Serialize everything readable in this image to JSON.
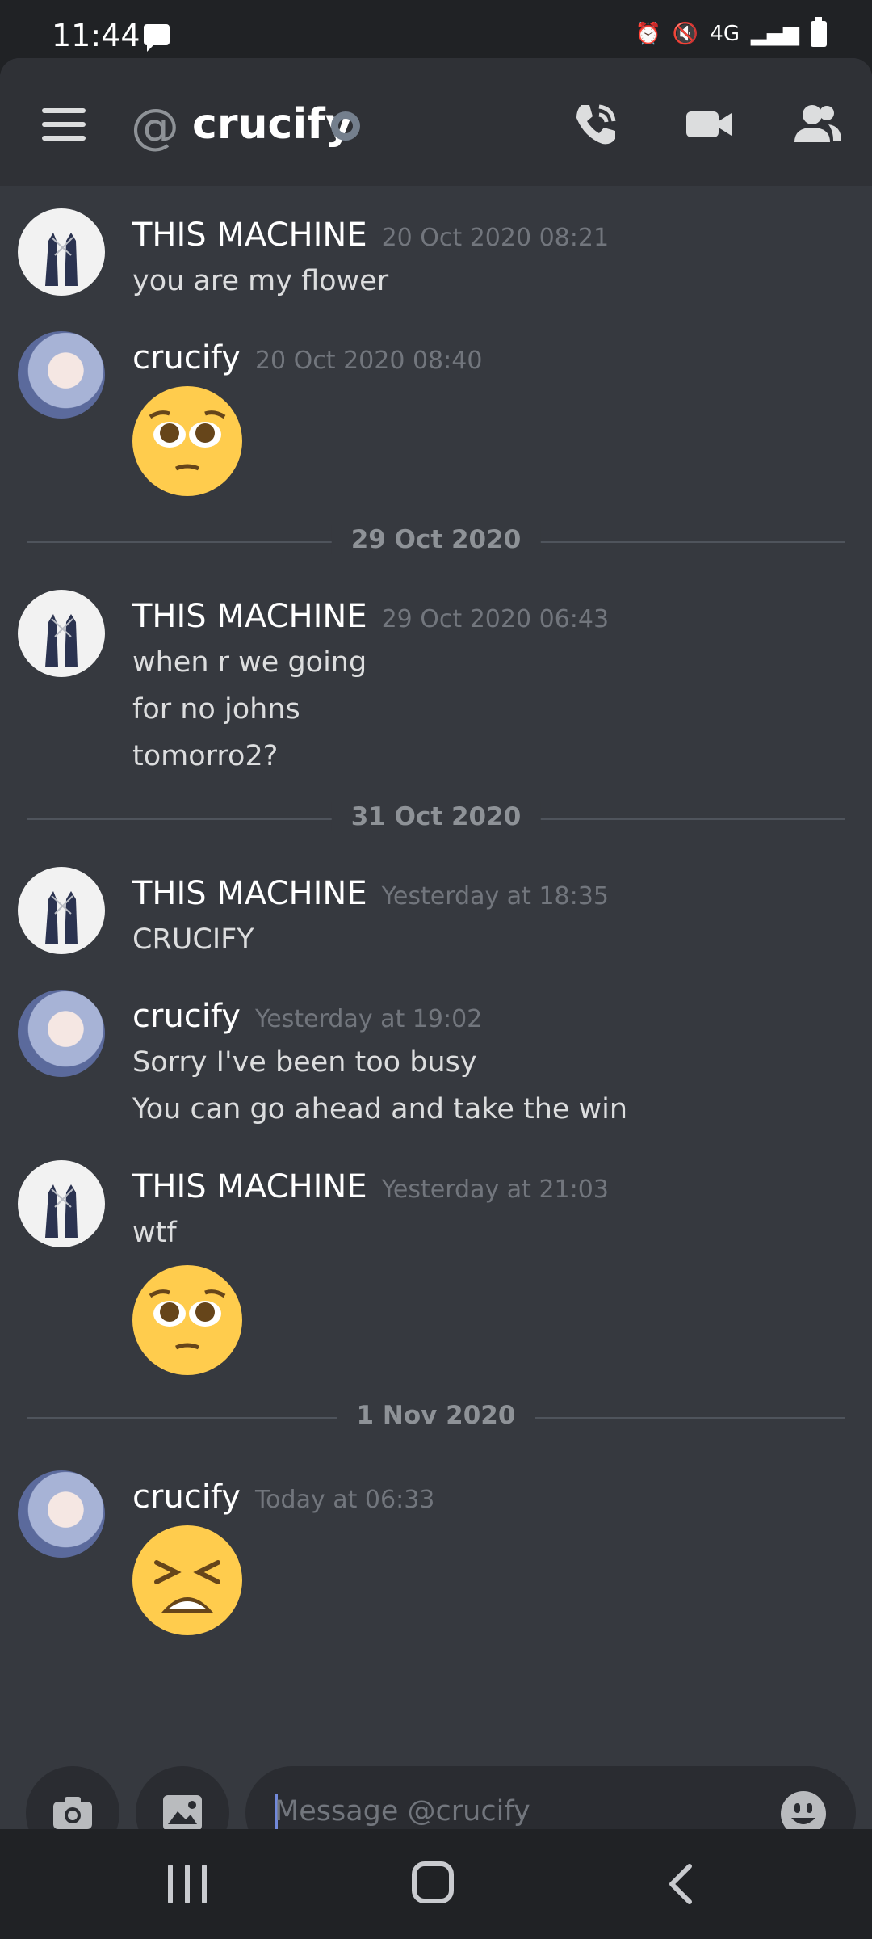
{
  "status_bar": {
    "time": "11:44",
    "network": "4G"
  },
  "header": {
    "title": "crucify"
  },
  "dividers": [
    "29 Oct 2020",
    "31 Oct 2020",
    "1 Nov 2020"
  ],
  "messages": [
    {
      "author": "THIS MACHINE",
      "time": "20 Oct 2020 08:21",
      "lines": [
        "you are my flower"
      ]
    },
    {
      "author": "crucify",
      "time": "20 Oct 2020 08:40",
      "emoji": "pleading-face"
    },
    {
      "author": "THIS MACHINE",
      "time": "29 Oct 2020 06:43",
      "lines": [
        "when r we going",
        "for no johns",
        "tomorro2?"
      ]
    },
    {
      "author": "THIS MACHINE",
      "time": "Yesterday at 18:35",
      "lines": [
        "CRUCIFY"
      ]
    },
    {
      "author": "crucify",
      "time": "Yesterday at 19:02",
      "lines": [
        "Sorry I've been too busy",
        "You can go ahead and take the win"
      ]
    },
    {
      "author": "THIS MACHINE",
      "time": "Yesterday at 21:03",
      "lines": [
        "wtf"
      ],
      "emoji": "pleading-face"
    },
    {
      "author": "crucify",
      "time": "Today at 06:33",
      "emoji": "tired-face"
    }
  ],
  "composer": {
    "placeholder": "Message @crucify"
  },
  "icons": [
    "menu-icon",
    "at-icon",
    "phone-icon",
    "video-icon",
    "members-icon",
    "camera-icon",
    "image-icon",
    "emoji-icon",
    "recents-icon",
    "home-icon",
    "back-icon"
  ],
  "colors": {
    "background": "#36393f",
    "header": "#2f3136",
    "accent": "#7289da",
    "emoji": "#ffcc4d"
  }
}
